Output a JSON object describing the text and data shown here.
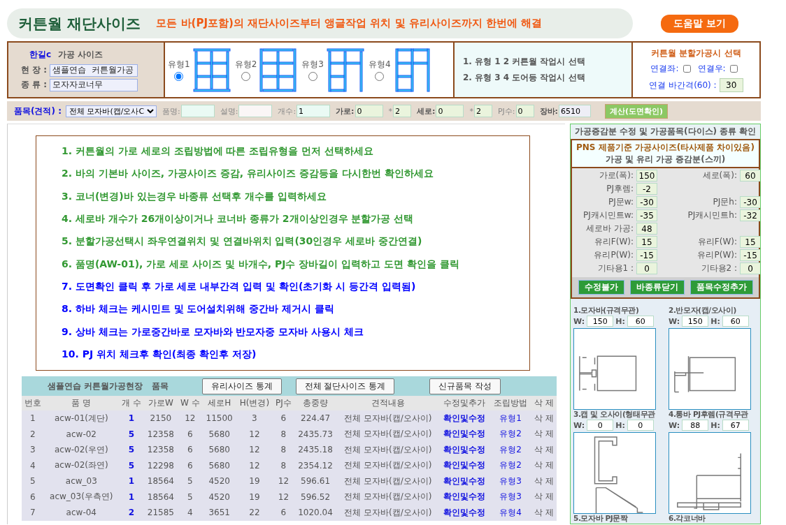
{
  "header": {
    "title": "커튼월 재단사이즈",
    "subtitle": "모든 바(PJ포함)의 재단사이즈부터 앵글작업 위치 및 유리사이즈까지 한번에 해결",
    "help_button": "도움말 보기"
  },
  "site_panel": {
    "brand": "한길c",
    "heading": "가공 사이즈",
    "fields": [
      {
        "label": "현 장 :",
        "value": "샘플연습  커튼월가공"
      },
      {
        "label": "종 류 :",
        "value": "모자자코너무"
      }
    ]
  },
  "types": [
    {
      "label": "유형1",
      "selected": true,
      "kind": "grid"
    },
    {
      "label": "유형2",
      "selected": false,
      "kind": "posts"
    },
    {
      "label": "유형3",
      "selected": false,
      "kind": "door"
    },
    {
      "label": "유형4",
      "selected": false,
      "kind": "gate"
    }
  ],
  "notes": [
    "1. 유형 1 2 커튼월 작업시 선택",
    "2. 유형 3 4 도어등 작업시 선택"
  ],
  "split": {
    "title": "커튼월 분할가공시 선택",
    "left_label": "연결좌:",
    "left_checked": false,
    "right_label": "연결우:",
    "right_checked": false,
    "gap_label": "연결 바간격(60) :",
    "gap_value": "30"
  },
  "form": {
    "item_label": "품목(견적) :",
    "item_value": "전체 모자바(캡/오사C",
    "fields": [
      {
        "label": "품명:",
        "kind": "mint",
        "emphasis": false
      },
      {
        "label": "설명:",
        "kind": "rose",
        "emphasis": false
      },
      {
        "label": "개수:",
        "value": "1",
        "kind": "mint",
        "emphasis": false
      },
      {
        "label": "가로:",
        "value": "0",
        "kind": "lime",
        "emphasis": true
      },
      {
        "label": "*",
        "value": "2",
        "kind": "lime",
        "emphasis": false
      },
      {
        "label": "세로:",
        "value": "0",
        "kind": "lime",
        "emphasis": true
      },
      {
        "label": "*",
        "value": "2",
        "kind": "lime",
        "emphasis": false
      },
      {
        "label": "PJ수:",
        "value": "0",
        "kind": "lime",
        "emphasis": false
      },
      {
        "label": "장바:",
        "value": "6510",
        "kind": "lavender",
        "emphasis": true
      }
    ],
    "calc_button": "계산(도면확인)"
  },
  "instructions": [
    {
      "text": "1. 커튼월의 가로 세로의 조립방법에 따른 조립유형을 먼저 선택하세요",
      "color": "#339933"
    },
    {
      "text": "2. 바의 기본바 사이즈, 가공사이즈 증감, 유리사이즈 증감등을 다시한번 확인하세요",
      "color": "#339933"
    },
    {
      "text": "3. 코너(변경)바 있는경우 바종류 선택후 개수를 입력하세요",
      "color": "#339933"
    },
    {
      "text": "4. 세로바 개수가 26개이상이거나 코너바 종류가 2개이상인경우 분할가공 선택",
      "color": "#339933"
    },
    {
      "text": "5. 분할가공선택시 좌우연결위치 및 연결바위치 입력(30인경우 세로바 중간연결)",
      "color": "#339933"
    },
    {
      "text": "6. 품명(AW-01), 가로 세로 사이즈 및 바개수, PJ수 장바길이 입력하고 도면 확인을 클릭",
      "color": "#339933"
    },
    {
      "text": "7. 도면확인 클릭 후 가로 세로 내부간격 입력 및 확인(초기화 시 등간격 입력됨)",
      "color": "#0000ff"
    },
    {
      "text": "8. 하바 체크는 케시민트 및 도어설치위해 중간바 제거시 클릭",
      "color": "#0000ff"
    },
    {
      "text": "9. 상바 체크는 가로중간바로 모자바와 반모자중 모자바 사용시 체크",
      "color": "#0000ff"
    },
    {
      "text": "10. PJ 위치 체크후 확인(최종 확인후 저장)",
      "color": "#0000ff"
    }
  ],
  "table": {
    "title": "샘플연습 커튼월가공현장   품목",
    "buttons": [
      "유리사이즈 통계",
      "전체 절단사이즈 통계",
      "신규품목 작성"
    ],
    "columns": [
      {
        "label": "번호",
        "kind": "text"
      },
      {
        "label": "품 명",
        "kind": "text"
      },
      {
        "label": "개 수",
        "kind": "count"
      },
      {
        "label": "가로W",
        "kind": "text"
      },
      {
        "label": "W 수",
        "kind": "text"
      },
      {
        "label": "세로H",
        "kind": "text"
      },
      {
        "label": "H(변경)",
        "kind": "text"
      },
      {
        "label": "PJ수",
        "kind": "text"
      },
      {
        "label": "총중량",
        "kind": "text"
      },
      {
        "label": "견적내용",
        "kind": "text"
      },
      {
        "label": "수정및추가",
        "kind": "action"
      },
      {
        "label": "조립방법",
        "kind": "link"
      },
      {
        "label": "삭 제",
        "kind": "delete"
      }
    ],
    "rows": [
      [
        "1",
        "acw-01(계단)",
        "1",
        "2150",
        "12",
        "11500",
        "3",
        "6",
        "224.47",
        "전체 모자바(캡/오사이)",
        "확인및수정",
        "유형1",
        "삭 제"
      ],
      [
        "2",
        "acw-02",
        "5",
        "12358",
        "6",
        "5680",
        "12",
        "8",
        "2435.73",
        "전체 모자바(캡/오사이)",
        "확인및수정",
        "유형2",
        "삭 제"
      ],
      [
        "3",
        "acw-02(우연)",
        "5",
        "12358",
        "6",
        "5680",
        "12",
        "8",
        "2435.18",
        "전체 모자바(캡/오사이)",
        "확인및수정",
        "유형2",
        "삭 제"
      ],
      [
        "4",
        "acw-02(좌연)",
        "5",
        "12298",
        "6",
        "5680",
        "12",
        "8",
        "2354.12",
        "전체 모자바(캡/오사이)",
        "확인및수정",
        "유형2",
        "삭 제"
      ],
      [
        "5",
        "acw_03",
        "1",
        "18564",
        "5",
        "4520",
        "19",
        "12",
        "596.61",
        "전체 모자바(캡/오사이)",
        "확인및수정",
        "유형3",
        "삭 제"
      ],
      [
        "6",
        "acw_03(우측연)",
        "1",
        "18564",
        "5",
        "4520",
        "19",
        "12",
        "596.52",
        "전체 모자바(캡/오사이)",
        "확인및수정",
        "유형3",
        "삭 제"
      ],
      [
        "7",
        "acw-04",
        "2",
        "21585",
        "4",
        "3651",
        "22",
        "6",
        "1020.04",
        "전체 모자바(캡/오사이)",
        "확인및수정",
        "유형4",
        "삭 제"
      ]
    ]
  },
  "adjust_panel": {
    "heading": "가공증감분 수정 및 가공품목(다이스) 종류 확인",
    "box_title": [
      "PNS 제품기준 가공사이즈(타사제품 차이있음)",
      "가공 및 유리 가공 증감분(스끼)"
    ],
    "params": [
      [
        {
          "label": "가로(폭):",
          "value": "150"
        },
        {
          "label": "세로(폭):",
          "value": "60"
        }
      ],
      [
        {
          "label": "PJ후렘:",
          "value": "-2"
        }
      ],
      [
        {
          "label": "PJ문w:",
          "value": "-30"
        },
        {
          "label": "PJ문h:",
          "value": "-30"
        }
      ],
      [
        {
          "label": "PJ캐시민트w:",
          "value": "-35"
        },
        {
          "label": "PJ캐시민트h:",
          "value": "-32"
        }
      ],
      [
        {
          "label": "세로바 가공:",
          "value": "48"
        }
      ],
      [
        {
          "label": "유리F(W):",
          "value": "15"
        },
        {
          "label": "유리F(W):",
          "value": "15"
        }
      ],
      [
        {
          "label": "유리P(W):",
          "value": "-15"
        },
        {
          "label": "유리P(W):",
          "value": "-15"
        }
      ],
      [
        {
          "label": "기타용1 :",
          "value": "0"
        },
        {
          "label": "기타용2 :",
          "value": "0"
        }
      ]
    ],
    "buttons": [
      "수정불가",
      "바종류닫기",
      "품목수정추가"
    ],
    "profiles": [
      {
        "title": "1.모자바(규격무관)",
        "inputs": [
          {
            "label": "W:",
            "value": "150"
          },
          {
            "label": "H:",
            "value": "60"
          }
        ],
        "kind": "cap"
      },
      {
        "title": "2.반모자(캡/오사이)",
        "inputs": [
          {
            "label": "W:",
            "value": "150"
          },
          {
            "label": "H:",
            "value": "60"
          }
        ],
        "kind": "half"
      },
      {
        "title": "3.캡 및 오사이(형태무관",
        "inputs": [
          {
            "label": "W:",
            "value": "0"
          },
          {
            "label": "H:",
            "value": "0"
          }
        ],
        "kind": "clip"
      },
      {
        "title": "4.통바 PJ후렘(규격무관",
        "inputs": [
          {
            "label": "W:",
            "value": "88"
          },
          {
            "label": "H:",
            "value": "67"
          }
        ],
        "kind": "frame"
      },
      {
        "title": "5.모자바 PJ문짝"
      },
      {
        "title": "6.각코너바"
      }
    ]
  }
}
